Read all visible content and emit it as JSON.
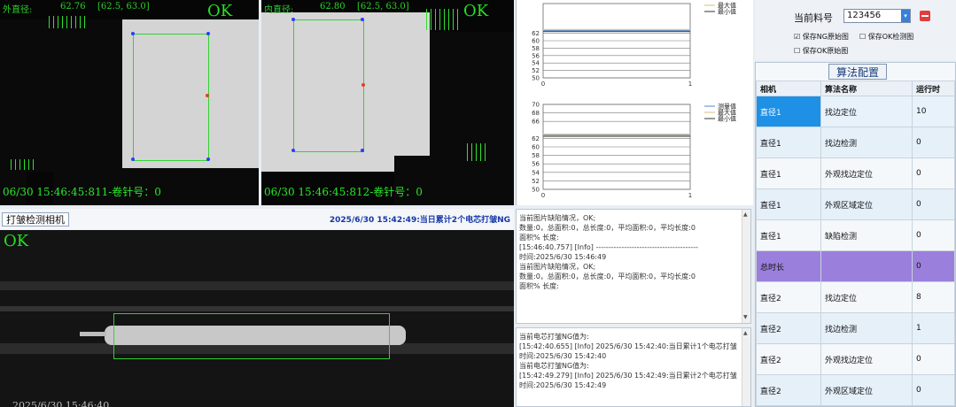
{
  "camera1": {
    "label": "外直径:",
    "value": "62.76",
    "range": "[62.5, 63.0]",
    "status": "OK",
    "timestamp": "06/30 15:46:45:811-卷针号：0"
  },
  "camera2": {
    "label": "内直径:",
    "value": "62.80",
    "range": "[62.5, 63.0]",
    "status": "OK",
    "timestamp": "06/30 15:46:45:812-卷针号：0"
  },
  "camera3": {
    "title": "打皱检测相机",
    "status": "OK",
    "notice": "2025/6/30 15:42:49:当日累计2个电芯打皱NG",
    "timestamp": "2025/6/30 15:46:40"
  },
  "chart_data": [
    {
      "type": "line",
      "y_ticks": [
        "60",
        "62",
        "58",
        "56",
        "54",
        "52",
        "50"
      ],
      "ylim": [
        50,
        70
      ],
      "xlim": [
        0,
        1
      ],
      "x_ticks": [
        "0",
        "1"
      ],
      "legend": [
        "最大值",
        "最小值"
      ],
      "series": [
        {
          "name": "测量值",
          "values": [
            62.76,
            62.76
          ]
        },
        {
          "name": "最大值",
          "values": [
            63.0,
            63.0
          ]
        },
        {
          "name": "最小值",
          "values": [
            62.5,
            62.5
          ]
        }
      ]
    },
    {
      "type": "line",
      "y_ticks": [
        "70",
        "68",
        "66",
        "62",
        "60",
        "58",
        "56",
        "54",
        "52",
        "50"
      ],
      "ylim": [
        50,
        70
      ],
      "xlim": [
        0,
        1
      ],
      "x_ticks": [
        "0",
        "1"
      ],
      "legend": [
        "测量值",
        "最大值",
        "最小值"
      ],
      "series": [
        {
          "name": "测量值",
          "values": [
            62.8,
            62.8
          ]
        },
        {
          "name": "最大值",
          "values": [
            63.0,
            63.0
          ]
        },
        {
          "name": "最小值",
          "values": [
            62.5,
            62.5
          ]
        }
      ]
    }
  ],
  "log1": [
    "当前图片缺陷情况，OK;",
    "数量:0，总面积:0，总长度:0，平均面积:0，平均长度:0",
    "面积% 长度:",
    "",
    "[15:46:40.757] [Info] ----------------------------------------",
    "时间:2025/6/30 15:46:49",
    "当前图片缺陷情况，OK;",
    "数量:0，总面积:0，总长度:0，平均面积:0，平均长度:0",
    "面积% 长度:"
  ],
  "log2": [
    "当前电芯打皱NG值为:",
    "",
    "[15:42:40.655] [Info] 2025/6/30 15:42:40:当日累计1个电芯打皱",
    "时间:2025/6/30 15:42:40",
    "当前电芯打皱NG值为:",
    "",
    "[15:42:49.279] [Info] 2025/6/30 15:42:49:当日累计2个电芯打皱",
    "时间:2025/6/30 15:42:49"
  ],
  "settings": {
    "current_material_label": "当前料号",
    "current_material_value": "123456",
    "save_ng_label": "保存NG原始图",
    "save_ok_detect_label": "保存OK检测图",
    "save_ok_raw_label": "保存OK原始图",
    "save_ng_checked": true
  },
  "algo": {
    "title": "算法配置",
    "headers": [
      "相机",
      "算法名称",
      "运行时"
    ],
    "rows": [
      {
        "camera": "直径1",
        "name": "找边定位",
        "time": "10"
      },
      {
        "camera": "直径1",
        "name": "找边检测",
        "time": "0"
      },
      {
        "camera": "直径1",
        "name": "外观找边定位",
        "time": "0"
      },
      {
        "camera": "直径1",
        "name": "外观区域定位",
        "time": "0"
      },
      {
        "camera": "直径1",
        "name": "缺陷检测",
        "time": "0"
      },
      {
        "camera": "总时长",
        "name": "",
        "time": "0"
      },
      {
        "camera": "直径2",
        "name": "找边定位",
        "time": "8"
      },
      {
        "camera": "直径2",
        "name": "找边检测",
        "time": "1"
      },
      {
        "camera": "直径2",
        "name": "外观找边定位",
        "time": "0"
      },
      {
        "camera": "直径2",
        "name": "外观区域定位",
        "time": "0"
      }
    ]
  },
  "colors": {
    "selected_row": "#1e90e6",
    "total_row": "#9b7fdc",
    "overlay_green": "#28e828"
  }
}
